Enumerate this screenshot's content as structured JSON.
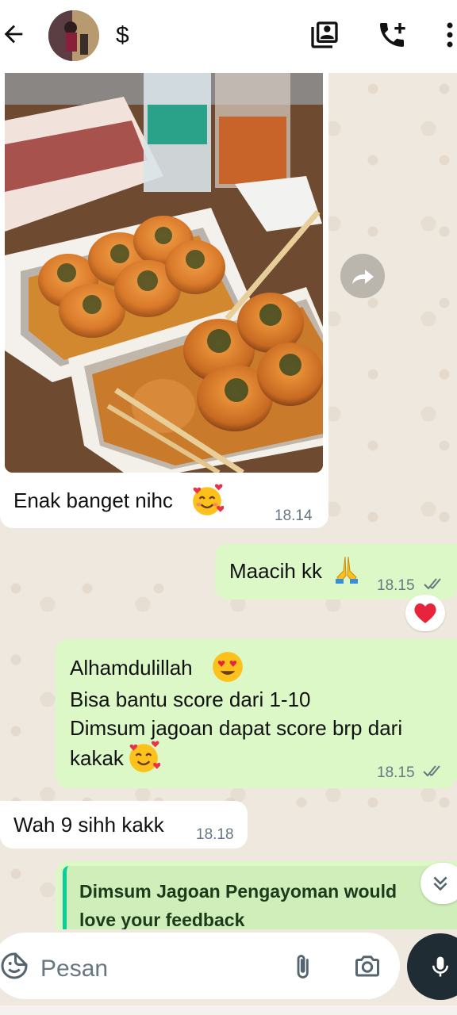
{
  "header": {
    "contact_name": "$",
    "icons": [
      "back-arrow-icon",
      "avatar",
      "contacts-icon",
      "add-call-icon",
      "more-vertical-icon"
    ]
  },
  "messages": [
    {
      "type": "image",
      "direction": "in",
      "caption": "Enak banget nihc",
      "emoji": "smiling-face-with-hearts",
      "time": "18.14"
    },
    {
      "type": "text",
      "direction": "out",
      "text": "Maacih kk",
      "emoji": "folded-hands",
      "time": "18.15",
      "status": "read",
      "reaction": "red-heart"
    },
    {
      "type": "text",
      "direction": "out",
      "lines": [
        "Alhamdulillah",
        "Bisa bantu score dari 1-10",
        "Dimsum jagoan dapat score brp dari",
        "kakak"
      ],
      "time": "18.15",
      "status": "read"
    },
    {
      "type": "text",
      "direction": "in",
      "text": "Wah 9 sihh kakk",
      "time": "18.18"
    },
    {
      "type": "text",
      "direction": "out",
      "lines": [
        "Dimsum Jagoan Pengayoman would",
        "love your feedback"
      ]
    }
  ],
  "composer": {
    "placeholder": "Pesan"
  },
  "colors": {
    "outgoing_bubble": "#dbf8c6",
    "incoming_bubble": "#ffffff",
    "wallpaper": "#efe8de",
    "accent": "#06cf9c",
    "mic_button": "#1f2c34"
  }
}
